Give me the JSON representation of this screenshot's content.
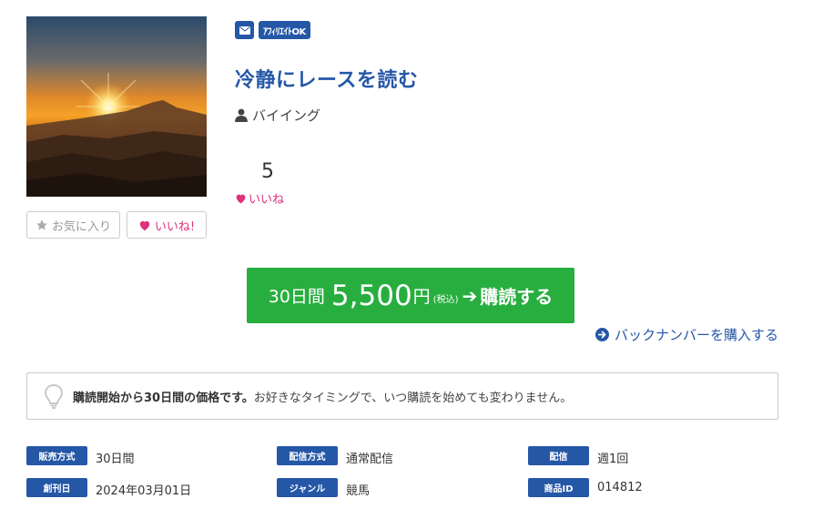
{
  "product": {
    "title": "冷静にレースを読む",
    "author": "バイイング",
    "badges": {
      "affiliate": "ｱﾌｨﾘｴｲﾄOK"
    },
    "likes": {
      "count": "5",
      "label": "いいね"
    }
  },
  "actions": {
    "favorite": "お気に入り",
    "like": "いいね!"
  },
  "subscribe": {
    "period": "30日間",
    "price": "5,500",
    "yen": "円",
    "tax": "(税込)",
    "arrow": "➔",
    "action": "購読する"
  },
  "backnumber": {
    "label": "バックナンバーを購入する"
  },
  "notice": {
    "bold": "購読開始から30日間の価格です。",
    "text": "お好きなタイミングで、いつ購読を始めても変わりません。"
  },
  "info": [
    {
      "label": "販売方式",
      "value": "30日間"
    },
    {
      "label": "配信方式",
      "value": "通常配信"
    },
    {
      "label": "配信",
      "value": "週1回"
    },
    {
      "label": "創刊日",
      "value": "2024年03月01日"
    },
    {
      "label": "ジャンル",
      "value": "競馬"
    },
    {
      "label": "商品ID",
      "value": "014812"
    }
  ],
  "colors": {
    "brand_blue": "#2557a7",
    "buy_green": "#27ae3f",
    "like_pink": "#e0317c"
  },
  "icons": {
    "mail": "envelope-icon",
    "user": "user-icon",
    "heart": "heart-icon",
    "star": "star-icon",
    "arrow_circle": "arrow-circle-right-icon",
    "bulb": "lightbulb-icon"
  }
}
